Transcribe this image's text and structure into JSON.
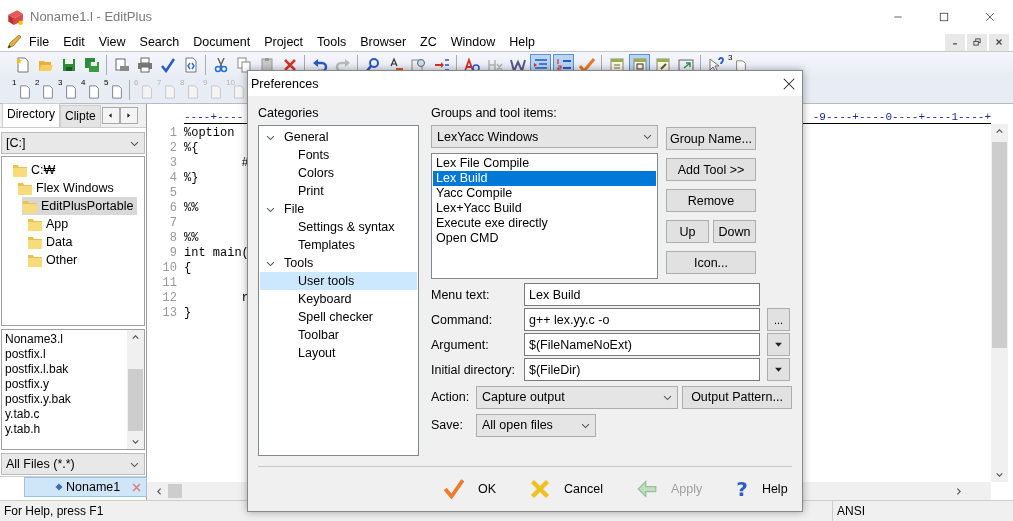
{
  "window": {
    "title": "Noname1.l - EditPlus"
  },
  "menu": [
    "File",
    "Edit",
    "View",
    "Search",
    "Document",
    "Project",
    "Tools",
    "Browser",
    "ZC",
    "Window",
    "Help"
  ],
  "toolbar": [
    {
      "kind": "new",
      "on": false
    },
    {
      "kind": "open",
      "on": false
    },
    {
      "kind": "save",
      "on": false
    },
    {
      "kind": "saveall",
      "on": false
    },
    {
      "kind": "sep"
    },
    {
      "kind": "preview",
      "on": false
    },
    {
      "kind": "print",
      "on": false
    },
    {
      "kind": "spell",
      "on": false
    },
    {
      "kind": "browser",
      "on": false
    },
    {
      "kind": "sep"
    },
    {
      "kind": "cut",
      "on": false
    },
    {
      "kind": "copy",
      "on": false
    },
    {
      "kind": "paste",
      "on": false
    },
    {
      "kind": "delete",
      "on": false
    },
    {
      "kind": "sep"
    },
    {
      "kind": "undo",
      "on": false
    },
    {
      "kind": "redo",
      "on": false
    },
    {
      "kind": "sep"
    },
    {
      "kind": "find",
      "on": false
    },
    {
      "kind": "replace",
      "on": false
    },
    {
      "kind": "findfiles",
      "on": false
    },
    {
      "kind": "goto",
      "on": false
    },
    {
      "kind": "sep"
    },
    {
      "kind": "font",
      "on": false
    },
    {
      "kind": "hex",
      "on": false
    },
    {
      "kind": "wordwrap",
      "on": false
    },
    {
      "kind": "indent",
      "on": true
    },
    {
      "kind": "linenumber",
      "on": true
    },
    {
      "kind": "check",
      "on": false
    },
    {
      "kind": "sep"
    },
    {
      "kind": "list",
      "on": false
    },
    {
      "kind": "layout",
      "on": true
    },
    {
      "kind": "edit",
      "on": false
    },
    {
      "kind": "window",
      "on": false
    },
    {
      "kind": "sep"
    },
    {
      "kind": "help",
      "on": false
    },
    {
      "kind": "page",
      "label": "3"
    }
  ],
  "doc_toolbar": [
    {
      "label": "1",
      "disabled": false
    },
    {
      "label": "2",
      "disabled": false
    },
    {
      "label": "3",
      "disabled": false
    },
    {
      "label": "4",
      "disabled": false
    },
    {
      "label": "5",
      "disabled": false
    },
    {
      "label": "6",
      "disabled": true
    },
    {
      "label": "7",
      "disabled": true
    },
    {
      "label": "8",
      "disabled": true
    },
    {
      "label": "9",
      "disabled": true
    },
    {
      "label": "10",
      "disabled": true
    }
  ],
  "sidebar": {
    "tabs": [
      {
        "label": "Directory",
        "selected": true
      },
      {
        "label": "Clipte",
        "selected": false
      }
    ],
    "drive": "[C:]",
    "tree": [
      {
        "label": "C:₩",
        "selected": false,
        "children": [
          {
            "label": "Flex Windows",
            "selected": false,
            "children": [
              {
                "label": "EditPlusPortable",
                "selected": true,
                "children": [
                  {
                    "label": "App",
                    "selected": false
                  },
                  {
                    "label": "Data",
                    "selected": false
                  },
                  {
                    "label": "Other",
                    "selected": false
                  }
                ]
              }
            ]
          }
        ]
      }
    ],
    "files": [
      "Noname3.l",
      "postfix.l",
      "postfix.l.bak",
      "postfix.y",
      "postfix.y.bak",
      "y.tab.c",
      "y.tab.h"
    ],
    "filter": "All Files (*.*)"
  },
  "document_tabs": [
    {
      "label": "Noname1",
      "selected": true
    }
  ],
  "editor": {
    "ruler_left": "----+----",
    "ruler_right": "-9----+----0----+----1----+",
    "lines": [
      {
        "number": "1",
        "text": "%option"
      },
      {
        "number": "2",
        "text": "%{"
      },
      {
        "number": "3",
        "text": "\t#"
      },
      {
        "number": "4",
        "text": "%}"
      },
      {
        "number": "5"
      },
      {
        "number": "6",
        "text": "%%"
      },
      {
        "number": "7"
      },
      {
        "number": "8",
        "text": "%%"
      },
      {
        "number": "9",
        "text": "int main("
      },
      {
        "number": "10",
        "text": "{"
      },
      {
        "number": "11"
      },
      {
        "number": "12",
        "text": "\tr"
      },
      {
        "number": "13",
        "text": "}"
      }
    ]
  },
  "status_bar": {
    "message": "For Help, press F1",
    "encoding": "ANSI"
  },
  "dialog": {
    "title": "Preferences",
    "categories": {
      "label": "Categories",
      "items": [
        {
          "label": "General",
          "expanded": true,
          "selected": false,
          "children": [
            {
              "label": "Fonts",
              "selected": false
            },
            {
              "label": "Colors",
              "selected": false
            },
            {
              "label": "Print",
              "selected": false
            }
          ]
        },
        {
          "label": "File",
          "expanded": true,
          "selected": false,
          "children": [
            {
              "label": "Settings & syntax",
              "selected": false
            },
            {
              "label": "Templates",
              "selected": false
            }
          ]
        },
        {
          "label": "Tools",
          "expanded": true,
          "selected": false,
          "children": [
            {
              "label": "User tools",
              "selected": true
            },
            {
              "label": "Keyboard",
              "selected": false
            },
            {
              "label": "Spell checker",
              "selected": false
            },
            {
              "label": "Toolbar",
              "selected": false
            },
            {
              "label": "Layout",
              "selected": false
            }
          ]
        }
      ]
    },
    "tools": {
      "label": "Groups and tool items:",
      "group": "LexYacc Windows",
      "items": [
        {
          "label": "Lex File Compile",
          "selected": false
        },
        {
          "label": "Lex Build",
          "selected": true
        },
        {
          "label": "Yacc Compile",
          "selected": false
        },
        {
          "label": "Lex+Yacc Build",
          "selected": false
        },
        {
          "label": "Execute exe directly",
          "selected": false
        },
        {
          "label": "Open CMD",
          "selected": false
        }
      ],
      "buttons": [
        [
          "Group Name..."
        ],
        [
          "Add Tool >>"
        ],
        [
          "Remove"
        ],
        [
          "Up",
          "Down"
        ],
        [
          "Icon..."
        ]
      ]
    },
    "fields": [
      {
        "label": "Menu text:",
        "value": "Lex Build",
        "kind": "plain"
      },
      {
        "label": "Command:",
        "value": "g++ lex.yy.c -o",
        "kind": "browse",
        "button": "..."
      },
      {
        "label": "Argument:",
        "value": "$(FileNameNoExt)",
        "kind": "menu"
      },
      {
        "label": "Initial directory:",
        "value": "$(FileDir)",
        "kind": "menu"
      }
    ],
    "action": {
      "label": "Action:",
      "value": "Capture output",
      "button": "Output Pattern..."
    },
    "save": {
      "label": "Save:",
      "value": "All open files"
    },
    "footer": [
      {
        "label": "OK",
        "kind": "ok",
        "disabled": false
      },
      {
        "label": "Cancel",
        "kind": "cancel",
        "disabled": false
      },
      {
        "label": "Apply",
        "kind": "apply",
        "disabled": true
      },
      {
        "label": "Help",
        "kind": "help",
        "disabled": false,
        "icon": "?"
      }
    ]
  }
}
